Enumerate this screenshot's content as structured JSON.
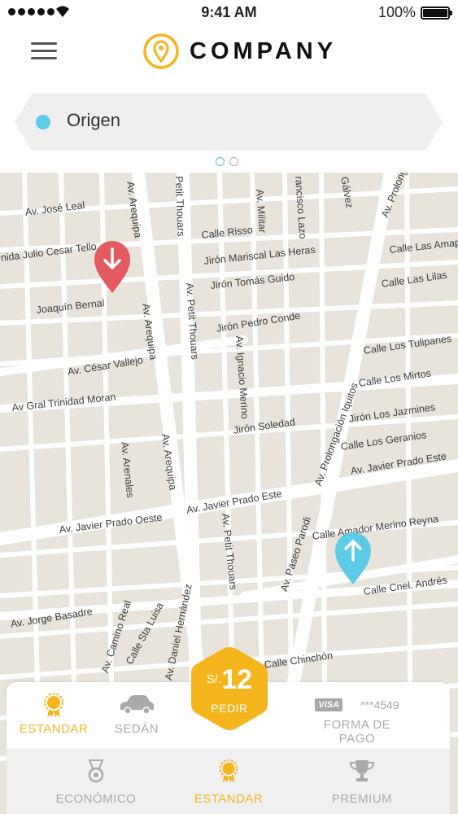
{
  "status_bar": {
    "time": "9:41 AM",
    "battery": "100%"
  },
  "header": {
    "brand": "COMPANY"
  },
  "origin": {
    "value": "Origen"
  },
  "map": {
    "streets": [
      "Av. José Leal",
      "nida Julio Cesar Tello",
      "Joaquín Bernal",
      "Av. César Vallejo",
      "Av Gral Trinidad Moran",
      "Av. Arequipa",
      "Av. Arequipa",
      "Av. Arequipa",
      "Petit Thouars",
      "Av. Petit Thouars",
      "Av. Petit Thouars",
      "Calle Risso",
      "Jirón Mariscal Las Heras",
      "Jirón Tomás Guido",
      "Jirón Pedro Conde",
      "Av. Ignacio Merino",
      "Av. Militar",
      "rancisco Lazo",
      "Gálvez",
      "Av. Prolongación",
      "Calle Las Amap",
      "Calle Las Lilas",
      "Calle Los Tulipanes",
      "Calle Los Mirtos",
      "Jirón Los Jazmines",
      "Calle Los Geranios",
      "Av. Prolongación Iquitos",
      "Jirón Soledad",
      "Av. Javier Prado Este",
      "Av. Javier Prado Este",
      "Av. Javier Prado Oeste",
      "Av. Arenales",
      "Calle Amador Merino Reyna",
      "Av. Paseo Parodi",
      "Calle Cnel. Andrés",
      "Av. Jorge Basadre",
      "Av. Camino Real",
      "Calle Sta Luisa",
      "Av. Daniel Hernández",
      "Calle Chinchón"
    ]
  },
  "panel": {
    "estandar": "ESTANDAR",
    "sedan": "SEDÁN",
    "card_brand": "VISA",
    "card_number": "***4549",
    "payment": "FORMA DE PAGO",
    "price_currency": "S/.",
    "price_amount": "12",
    "pedir": "PEDIR",
    "tiers": {
      "economico": "ECONÓMICO",
      "estandar": "ESTANDAR",
      "premium": "PREMIUM"
    }
  },
  "colors": {
    "accent": "#F3B51B",
    "origin_dot": "#5CCBE8",
    "pin_dropoff": "#E35A5F",
    "pin_pickup": "#5CCBE8",
    "map_bg": "#E8E4DC"
  },
  "icons": [
    "wifi-icon",
    "menu-icon",
    "location-pin-logo-icon",
    "medal-icon",
    "car-icon",
    "visa-card-icon",
    "tier-medal-icon",
    "trophy-icon",
    "dropoff-pin-icon",
    "pickup-pin-icon"
  ]
}
